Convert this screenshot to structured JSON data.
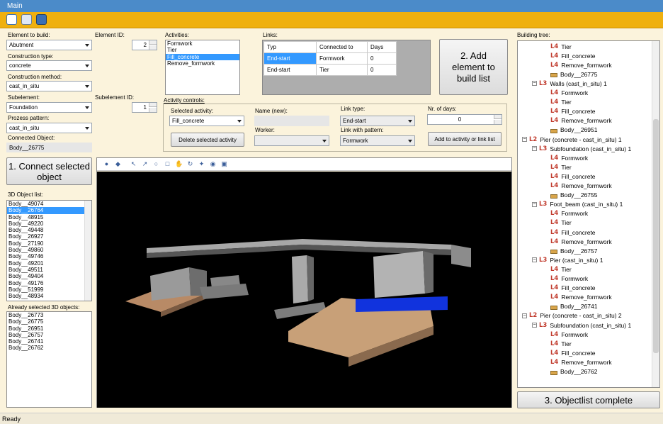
{
  "window": {
    "title": "Main"
  },
  "toolbar": {
    "icons": [
      "new-file-icon",
      "edit-pencil-icon",
      "save-icon"
    ]
  },
  "left": {
    "element_to_build_label": "Element to build:",
    "element_to_build": "Abutment",
    "construction_type_label": "Construction type:",
    "construction_type": "concrete",
    "construction_method_label": "Construction method:",
    "construction_method": "cast_in_situ",
    "subelement_label": "Subelement:",
    "subelement": "Foundation",
    "process_pattern_label": "Prozess pattern:",
    "process_pattern": "cast_in_situ",
    "connected_object_label": "Connected Object:",
    "connected_object": "Body__26775",
    "connect_button": "1. Connect selected object",
    "object_list_label": "3D Object list:",
    "object_list": [
      "Body__49074",
      "Body__26764",
      "Body__48915",
      "Body__49220",
      "Body__49448",
      "Body__26927",
      "Body__27190",
      "Body__49860",
      "Body__49746",
      "Body__49201",
      "Body__49511",
      "Body__49404",
      "Body__49176",
      "Body__51999",
      "Body__48934"
    ],
    "object_list_selected": 1,
    "already_label": "Already selected 3D objects:",
    "already_list": [
      "Body__26773",
      "Body__26775",
      "Body__26951",
      "Body__26757",
      "Body__26741",
      "Body__26762"
    ]
  },
  "ids": {
    "element_id_label": "Element ID:",
    "element_id": "2",
    "subelement_id_label": "Subelement ID:",
    "subelement_id": "1"
  },
  "activities": {
    "label": "Activities:",
    "items": [
      "Formwork",
      "Tier",
      "Fill_concrete",
      "Remove_formwork"
    ],
    "selected": 2
  },
  "links": {
    "label": "Links:",
    "headers": [
      "Typ",
      "Connected to",
      "Days"
    ],
    "rows": [
      [
        "End-start",
        "Formwork",
        "0"
      ],
      [
        "End-start",
        "Tier",
        "0"
      ]
    ]
  },
  "add_button": "2. Add element to build list",
  "controls": {
    "label": "Activity controls:",
    "selected_activity_label": "Selected activity:",
    "selected_activity": "Fill_concrete",
    "delete_button": "Delete selected activity",
    "name_new_label": "Name (new):",
    "name_new": "",
    "worker_label": "Worker:",
    "worker": "",
    "link_type_label": "Link type:",
    "link_type": "End-start",
    "link_with_pattern_label": "Link with pattern:",
    "link_with_pattern": "Formwork",
    "days_label": "Nr. of days:",
    "days": "0",
    "add_activity_button": "Add to activity or link list"
  },
  "viewer": {
    "icons": [
      "home-icon",
      "scene-icon",
      "select-arrow-icon",
      "select-node-icon",
      "zoom-icon",
      "zoom-box-icon",
      "pan-hand-icon",
      "rotate-icon",
      "orbit-icon",
      "walk-icon",
      "view-cube-icon"
    ]
  },
  "tree": {
    "label": "Building tree:",
    "nodes": [
      {
        "level": "L4",
        "text": "Tier"
      },
      {
        "level": "L4",
        "text": "Fill_concrete"
      },
      {
        "level": "L4",
        "text": "Remove_formwork"
      },
      {
        "level": "body",
        "text": "Body__26775"
      },
      {
        "level": "L3",
        "text": "Walls (cast_in_situ) 1"
      },
      {
        "level": "L4",
        "text": "Formwork"
      },
      {
        "level": "L4",
        "text": "Tier"
      },
      {
        "level": "L4",
        "text": "Fill_concrete"
      },
      {
        "level": "L4",
        "text": "Remove_formwork"
      },
      {
        "level": "body",
        "text": "Body__26951"
      },
      {
        "level": "L2",
        "text": "Pier (concrete - cast_in_situ) 1"
      },
      {
        "level": "L3",
        "text": "Subfoundation (cast_in_situ) 1"
      },
      {
        "level": "L4",
        "text": "Formwork"
      },
      {
        "level": "L4",
        "text": "Tier"
      },
      {
        "level": "L4",
        "text": "Fill_concrete"
      },
      {
        "level": "L4",
        "text": "Remove_formwork"
      },
      {
        "level": "body",
        "text": "Body__26755"
      },
      {
        "level": "L3",
        "text": "Foot_beam (cast_in_situ) 1"
      },
      {
        "level": "L4",
        "text": "Formwork"
      },
      {
        "level": "L4",
        "text": "Tier"
      },
      {
        "level": "L4",
        "text": "Fill_concrete"
      },
      {
        "level": "L4",
        "text": "Remove_formwork"
      },
      {
        "level": "body",
        "text": "Body__26757"
      },
      {
        "level": "L3",
        "text": "Pier (cast_in_situ) 1"
      },
      {
        "level": "L4",
        "text": "Tier"
      },
      {
        "level": "L4",
        "text": "Formwork"
      },
      {
        "level": "L4",
        "text": "Fill_concrete"
      },
      {
        "level": "L4",
        "text": "Remove_formwork"
      },
      {
        "level": "body",
        "text": "Body__26741"
      },
      {
        "level": "L2",
        "text": "Pier (concrete - cast_in_situ) 2"
      },
      {
        "level": "L3",
        "text": "Subfoundation (cast_in_situ) 1"
      },
      {
        "level": "L4",
        "text": "Formwork"
      },
      {
        "level": "L4",
        "text": "Tier"
      },
      {
        "level": "L4",
        "text": "Fill_concrete"
      },
      {
        "level": "L4",
        "text": "Remove_formwork"
      },
      {
        "level": "body",
        "text": "Body__26762"
      }
    ]
  },
  "complete_button": "3. Objectlist complete",
  "status": "Ready"
}
